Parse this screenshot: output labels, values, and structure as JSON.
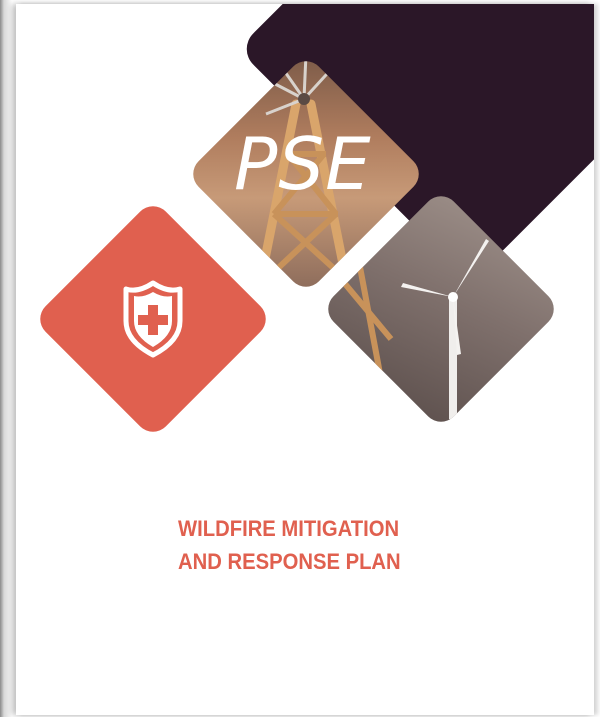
{
  "cover": {
    "logo_text": "PSE",
    "title_line1": "WILDFIRE MITIGATION",
    "title_line2": "AND RESPONSE PLAN"
  },
  "icons": {
    "shield": "shield-cross-icon",
    "windmill": "windmill-tower-icon",
    "wind_turbine": "wind-turbine-icon"
  },
  "colors": {
    "accent": "#e0604f",
    "dark": "#2b1728",
    "title": "#e0604f"
  }
}
